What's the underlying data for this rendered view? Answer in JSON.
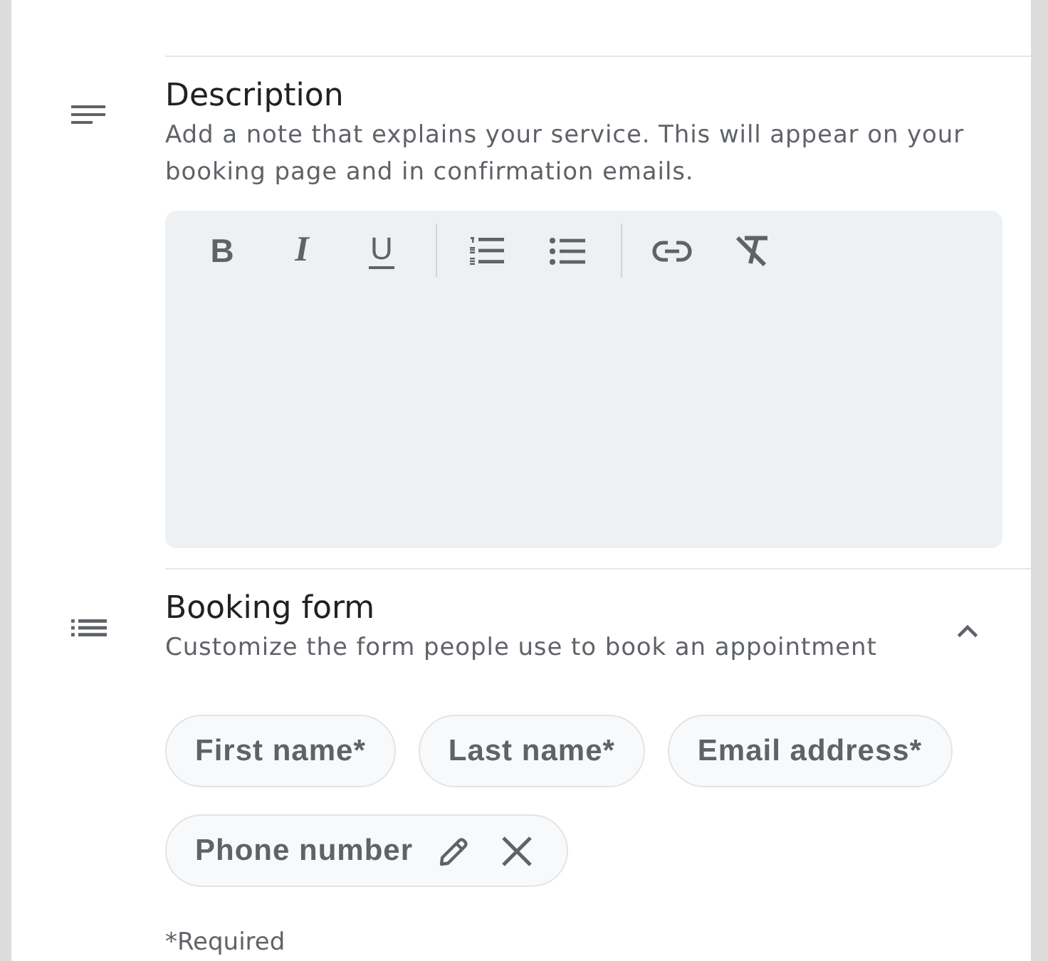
{
  "description": {
    "title": "Description",
    "subtitle": "Add a note that explains your service. This will appear on your booking page and in confirmation emails.",
    "editor": {
      "toolbar": [
        [
          {
            "kind": "bold",
            "label": "B"
          },
          {
            "kind": "italic",
            "label": "I"
          },
          {
            "kind": "underline",
            "label": "U"
          }
        ],
        [
          {
            "kind": "numbered-list"
          },
          {
            "kind": "bulleted-list"
          }
        ],
        [
          {
            "kind": "link"
          },
          {
            "kind": "clear-format"
          }
        ]
      ]
    }
  },
  "booking_form": {
    "title": "Booking form",
    "subtitle": "Customize the form people use to book an appointment",
    "expanded": true,
    "fields": [
      {
        "label": "First name*",
        "editable": false,
        "removable": false
      },
      {
        "label": "Last name*",
        "editable": false,
        "removable": false
      },
      {
        "label": "Email address*",
        "editable": false,
        "removable": false
      },
      {
        "label": "Phone number",
        "editable": true,
        "removable": true
      }
    ],
    "footnote": "*Required"
  }
}
